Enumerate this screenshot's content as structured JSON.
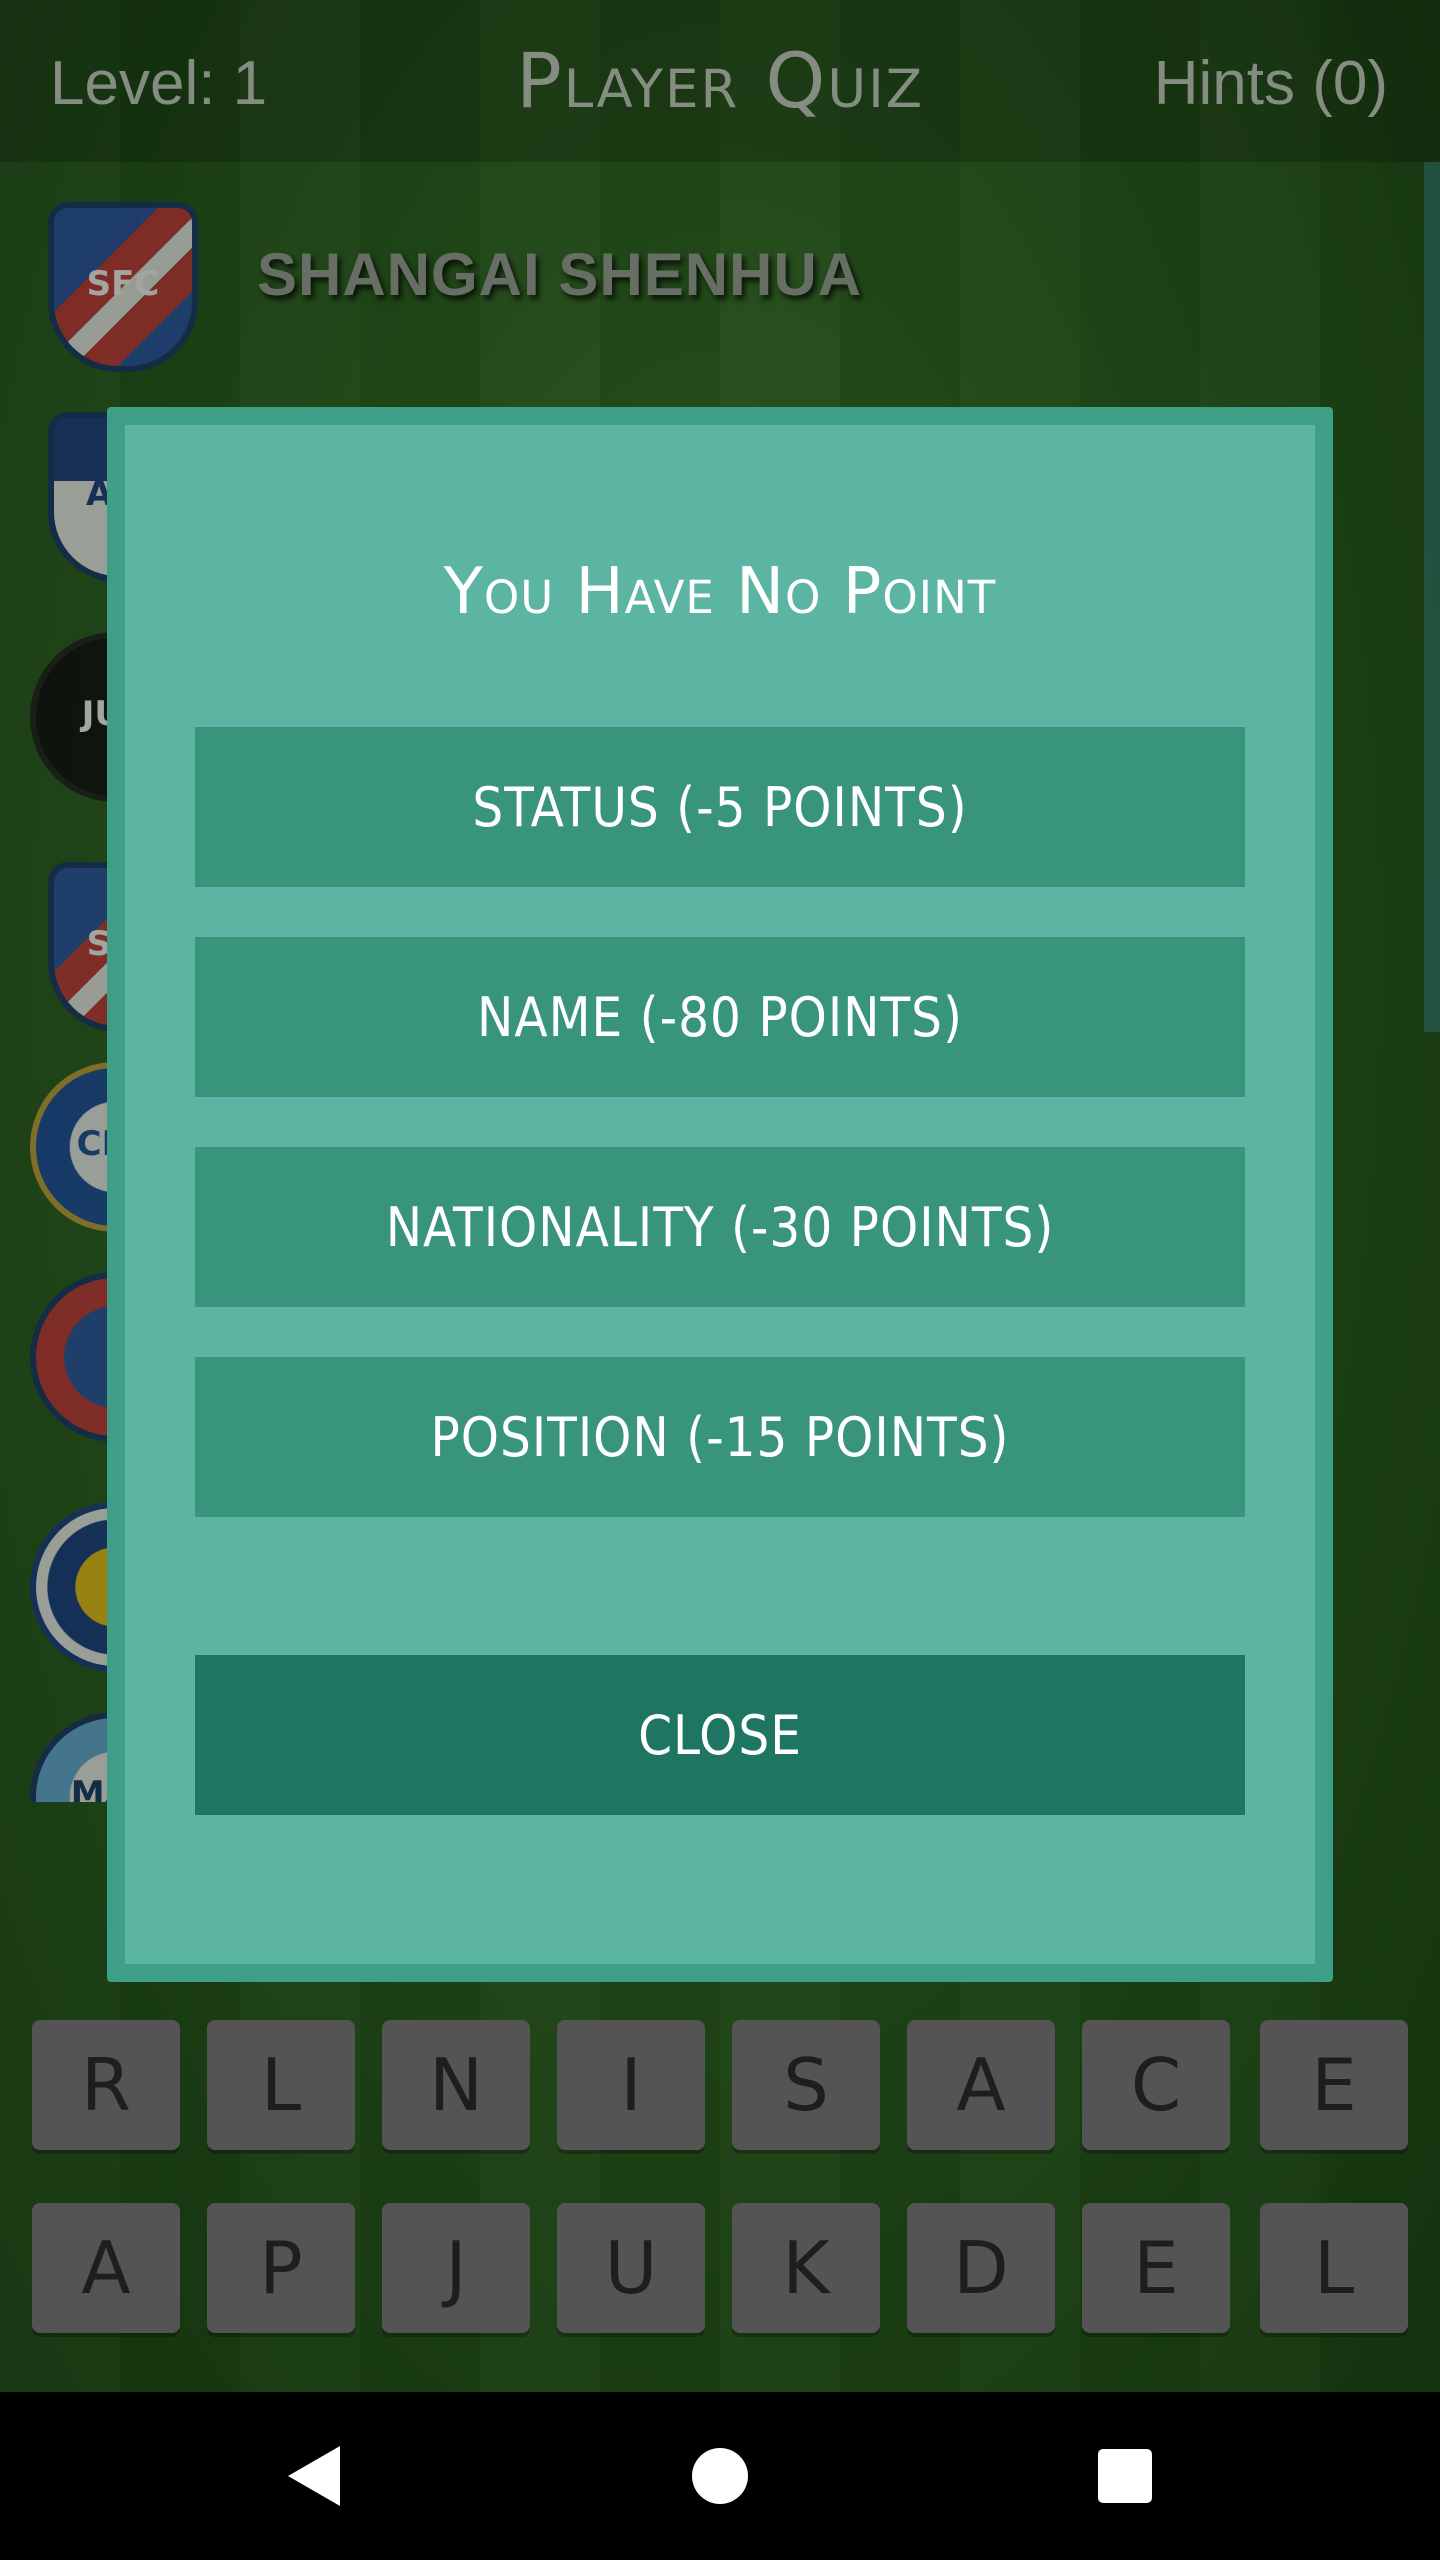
{
  "header": {
    "level_label": "Level: 1",
    "title": "Player Quiz",
    "hints_label": "Hints (0)"
  },
  "club_list": {
    "selected_club": "SHANGAI SHENHUA",
    "crests": [
      {
        "icon": "shanghai-shenhua-crest-icon",
        "abbr": "SFC"
      },
      {
        "icon": "west-brom-crest-icon",
        "abbr": "ALB"
      },
      {
        "icon": "juventus-crest-icon",
        "abbr": "JUV"
      },
      {
        "icon": "shanghai-shenhua-crest-icon",
        "abbr": "SFC"
      },
      {
        "icon": "chelsea-crest-icon",
        "abbr": "CHE"
      },
      {
        "icon": "club-crest-icon",
        "abbr": ""
      },
      {
        "icon": "fenerbahce-crest-icon",
        "abbr": ""
      },
      {
        "icon": "manchester-city-crest-icon",
        "abbr": "MAN"
      }
    ]
  },
  "dialog": {
    "title": "You Have No Point",
    "options": [
      {
        "label": "STATUS (-5 POINTS)"
      },
      {
        "label": "NAME (-80 POINTS)"
      },
      {
        "label": "NATIONALITY (-30 POINTS)"
      },
      {
        "label": "POSITION (-15 POINTS)"
      }
    ],
    "close_label": "CLOSE"
  },
  "keyboard": {
    "row1": [
      "R",
      "L",
      "N",
      "I",
      "S",
      "A",
      "C",
      "E"
    ],
    "row2": [
      "A",
      "P",
      "J",
      "U",
      "K",
      "D",
      "E",
      "L"
    ]
  },
  "navbar": {
    "icons": [
      "back-icon",
      "home-icon",
      "recent-apps-icon"
    ]
  },
  "colors": {
    "dialog_bg": "#5bb5a2",
    "dialog_border": "#3e9e87",
    "option_button": "#38947b",
    "close_button": "#1e7562",
    "key_bg": "#757575"
  }
}
